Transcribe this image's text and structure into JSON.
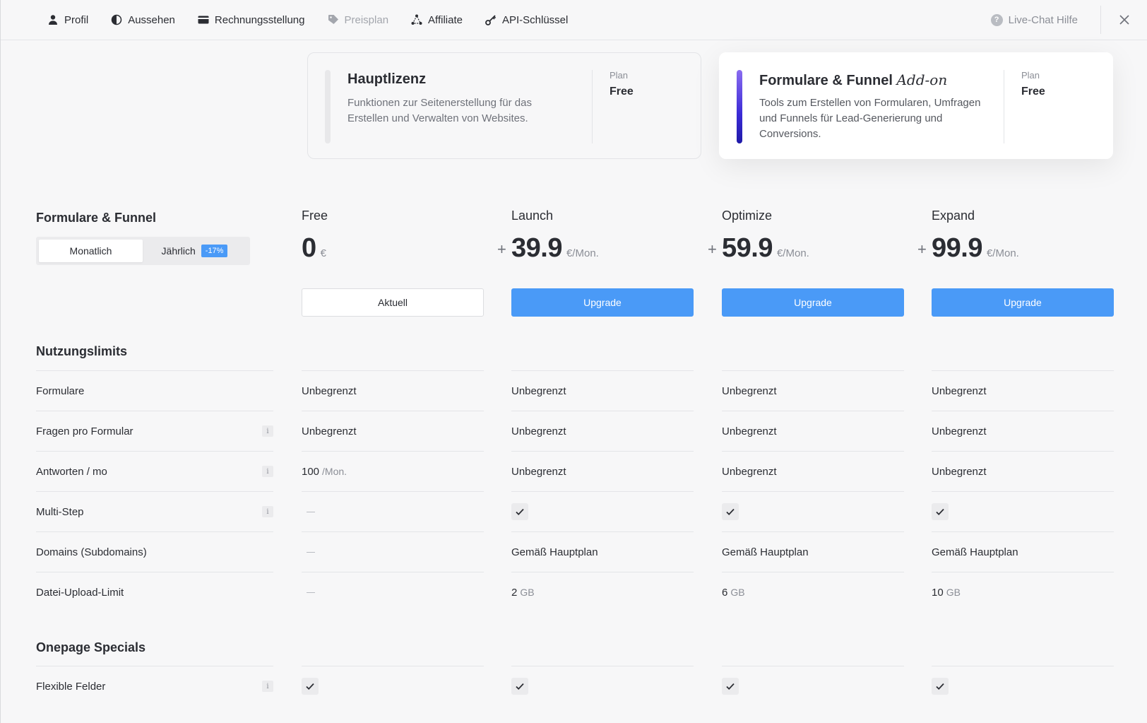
{
  "nav": {
    "items": [
      {
        "label": "Profil",
        "icon": "user-icon",
        "disabled": false
      },
      {
        "label": "Aussehen",
        "icon": "half-moon-icon",
        "disabled": false
      },
      {
        "label": "Rechnungsstellung",
        "icon": "credit-card-icon",
        "disabled": false
      },
      {
        "label": "Preisplan",
        "icon": "tag-icon",
        "disabled": true
      },
      {
        "label": "Affiliate",
        "icon": "network-icon",
        "disabled": false
      },
      {
        "label": "API-Schlüssel",
        "icon": "key-icon",
        "disabled": false
      }
    ],
    "help_label": "Live-Chat Hilfe",
    "help_icon": "question-icon",
    "close_icon": "close-icon"
  },
  "licenses": {
    "main": {
      "title": "Hauptlizenz",
      "description": "Funktionen zur Seitenerstellung für das Erstellen und Verwalten von Websites.",
      "plan_label": "Plan",
      "plan_value": "Free"
    },
    "addon": {
      "title": "Formulare & Funnel",
      "title_suffix": "Add-on",
      "description": "Tools zum Erstellen von Formularen, Umfragen und Funnels für Lead-Generierung und Conversions.",
      "plan_label": "Plan",
      "plan_value": "Free"
    }
  },
  "pricing": {
    "title": "Formulare & Funnel",
    "toggle": {
      "monthly": "Monatlich",
      "yearly": "Jährlich",
      "discount": "-17%"
    },
    "plans": [
      {
        "name": "Free",
        "plus": "",
        "price": "0",
        "unit": "€",
        "button": "Aktuell",
        "current": true
      },
      {
        "name": "Launch",
        "plus": "+",
        "price": "39.9",
        "unit": "€/Mon.",
        "button": "Upgrade",
        "current": false
      },
      {
        "name": "Optimize",
        "plus": "+",
        "price": "59.9",
        "unit": "€/Mon.",
        "button": "Upgrade",
        "current": false
      },
      {
        "name": "Expand",
        "plus": "+",
        "price": "99.9",
        "unit": "€/Mon.",
        "button": "Upgrade",
        "current": false
      }
    ]
  },
  "sections": {
    "usage": {
      "title": "Nutzungslimits",
      "rows": [
        {
          "label": "Formulare",
          "info": false,
          "values": [
            "Unbegrenzt",
            "Unbegrenzt",
            "Unbegrenzt",
            "Unbegrenzt"
          ]
        },
        {
          "label": "Fragen pro Formular",
          "info": true,
          "values": [
            "Unbegrenzt",
            "Unbegrenzt",
            "Unbegrenzt",
            "Unbegrenzt"
          ]
        },
        {
          "label": "Antworten / mo",
          "info": true,
          "values": [
            "100",
            "Unbegrenzt",
            "Unbegrenzt",
            "Unbegrenzt"
          ],
          "units": [
            "/Mon.",
            "",
            "",
            ""
          ]
        },
        {
          "label": "Multi-Step",
          "info": true,
          "values": [
            "dash",
            "check",
            "check",
            "check"
          ]
        },
        {
          "label": "Domains (Subdomains)",
          "info": false,
          "values": [
            "dash",
            "Gemäß Hauptplan",
            "Gemäß Hauptplan",
            "Gemäß Hauptplan"
          ]
        },
        {
          "label": "Datei-Upload-Limit",
          "info": false,
          "values": [
            "dash",
            "2",
            "6",
            "10"
          ],
          "units": [
            "",
            "GB",
            "GB",
            "GB"
          ]
        }
      ]
    },
    "specials": {
      "title": "Onepage Specials",
      "rows": [
        {
          "label": "Flexible Felder",
          "info": true,
          "values": [
            "check",
            "check",
            "check",
            "check"
          ]
        }
      ]
    }
  },
  "info_glyph": "i"
}
